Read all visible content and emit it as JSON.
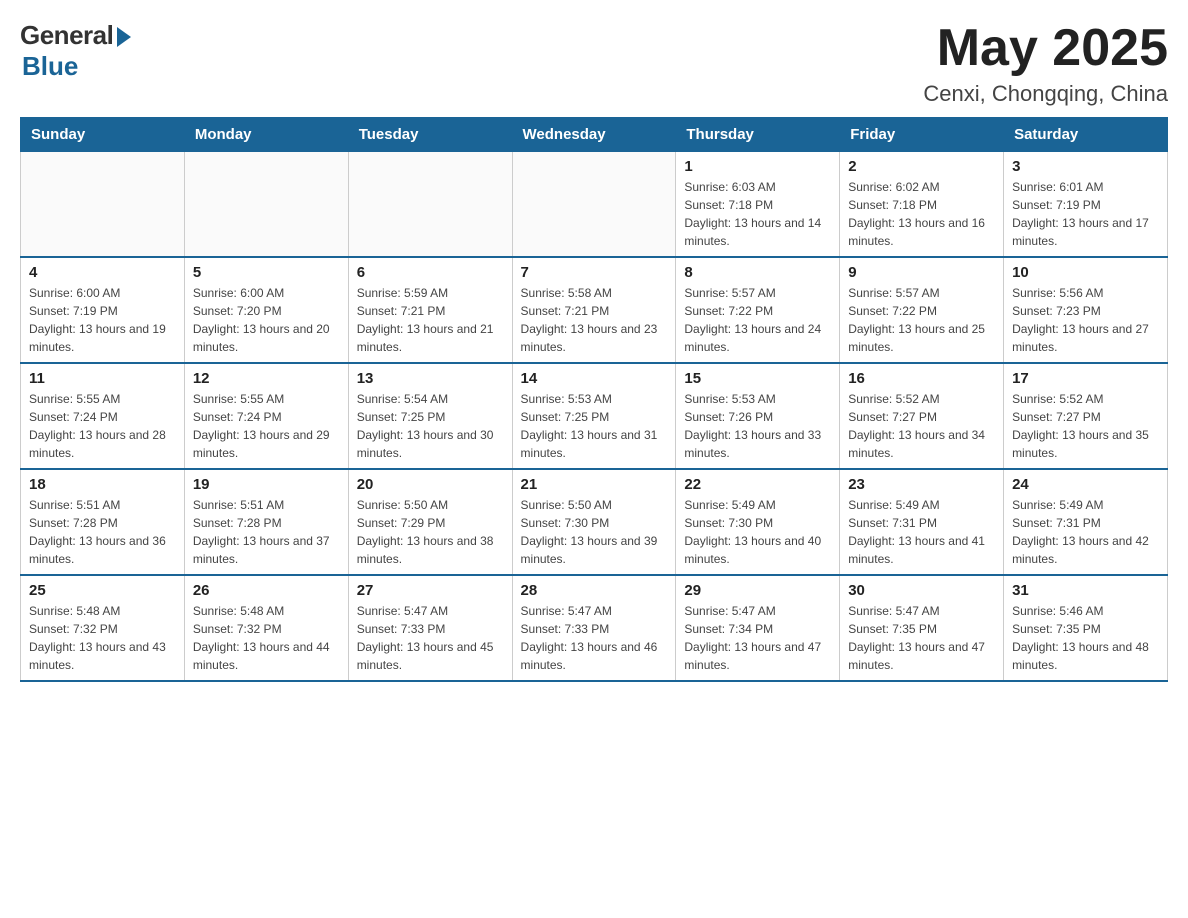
{
  "logo": {
    "general": "General",
    "blue": "Blue"
  },
  "title": "May 2025",
  "subtitle": "Cenxi, Chongqing, China",
  "days_header": [
    "Sunday",
    "Monday",
    "Tuesday",
    "Wednesday",
    "Thursday",
    "Friday",
    "Saturday"
  ],
  "weeks": [
    [
      {
        "day": "",
        "info": ""
      },
      {
        "day": "",
        "info": ""
      },
      {
        "day": "",
        "info": ""
      },
      {
        "day": "",
        "info": ""
      },
      {
        "day": "1",
        "info": "Sunrise: 6:03 AM\nSunset: 7:18 PM\nDaylight: 13 hours and 14 minutes."
      },
      {
        "day": "2",
        "info": "Sunrise: 6:02 AM\nSunset: 7:18 PM\nDaylight: 13 hours and 16 minutes."
      },
      {
        "day": "3",
        "info": "Sunrise: 6:01 AM\nSunset: 7:19 PM\nDaylight: 13 hours and 17 minutes."
      }
    ],
    [
      {
        "day": "4",
        "info": "Sunrise: 6:00 AM\nSunset: 7:19 PM\nDaylight: 13 hours and 19 minutes."
      },
      {
        "day": "5",
        "info": "Sunrise: 6:00 AM\nSunset: 7:20 PM\nDaylight: 13 hours and 20 minutes."
      },
      {
        "day": "6",
        "info": "Sunrise: 5:59 AM\nSunset: 7:21 PM\nDaylight: 13 hours and 21 minutes."
      },
      {
        "day": "7",
        "info": "Sunrise: 5:58 AM\nSunset: 7:21 PM\nDaylight: 13 hours and 23 minutes."
      },
      {
        "day": "8",
        "info": "Sunrise: 5:57 AM\nSunset: 7:22 PM\nDaylight: 13 hours and 24 minutes."
      },
      {
        "day": "9",
        "info": "Sunrise: 5:57 AM\nSunset: 7:22 PM\nDaylight: 13 hours and 25 minutes."
      },
      {
        "day": "10",
        "info": "Sunrise: 5:56 AM\nSunset: 7:23 PM\nDaylight: 13 hours and 27 minutes."
      }
    ],
    [
      {
        "day": "11",
        "info": "Sunrise: 5:55 AM\nSunset: 7:24 PM\nDaylight: 13 hours and 28 minutes."
      },
      {
        "day": "12",
        "info": "Sunrise: 5:55 AM\nSunset: 7:24 PM\nDaylight: 13 hours and 29 minutes."
      },
      {
        "day": "13",
        "info": "Sunrise: 5:54 AM\nSunset: 7:25 PM\nDaylight: 13 hours and 30 minutes."
      },
      {
        "day": "14",
        "info": "Sunrise: 5:53 AM\nSunset: 7:25 PM\nDaylight: 13 hours and 31 minutes."
      },
      {
        "day": "15",
        "info": "Sunrise: 5:53 AM\nSunset: 7:26 PM\nDaylight: 13 hours and 33 minutes."
      },
      {
        "day": "16",
        "info": "Sunrise: 5:52 AM\nSunset: 7:27 PM\nDaylight: 13 hours and 34 minutes."
      },
      {
        "day": "17",
        "info": "Sunrise: 5:52 AM\nSunset: 7:27 PM\nDaylight: 13 hours and 35 minutes."
      }
    ],
    [
      {
        "day": "18",
        "info": "Sunrise: 5:51 AM\nSunset: 7:28 PM\nDaylight: 13 hours and 36 minutes."
      },
      {
        "day": "19",
        "info": "Sunrise: 5:51 AM\nSunset: 7:28 PM\nDaylight: 13 hours and 37 minutes."
      },
      {
        "day": "20",
        "info": "Sunrise: 5:50 AM\nSunset: 7:29 PM\nDaylight: 13 hours and 38 minutes."
      },
      {
        "day": "21",
        "info": "Sunrise: 5:50 AM\nSunset: 7:30 PM\nDaylight: 13 hours and 39 minutes."
      },
      {
        "day": "22",
        "info": "Sunrise: 5:49 AM\nSunset: 7:30 PM\nDaylight: 13 hours and 40 minutes."
      },
      {
        "day": "23",
        "info": "Sunrise: 5:49 AM\nSunset: 7:31 PM\nDaylight: 13 hours and 41 minutes."
      },
      {
        "day": "24",
        "info": "Sunrise: 5:49 AM\nSunset: 7:31 PM\nDaylight: 13 hours and 42 minutes."
      }
    ],
    [
      {
        "day": "25",
        "info": "Sunrise: 5:48 AM\nSunset: 7:32 PM\nDaylight: 13 hours and 43 minutes."
      },
      {
        "day": "26",
        "info": "Sunrise: 5:48 AM\nSunset: 7:32 PM\nDaylight: 13 hours and 44 minutes."
      },
      {
        "day": "27",
        "info": "Sunrise: 5:47 AM\nSunset: 7:33 PM\nDaylight: 13 hours and 45 minutes."
      },
      {
        "day": "28",
        "info": "Sunrise: 5:47 AM\nSunset: 7:33 PM\nDaylight: 13 hours and 46 minutes."
      },
      {
        "day": "29",
        "info": "Sunrise: 5:47 AM\nSunset: 7:34 PM\nDaylight: 13 hours and 47 minutes."
      },
      {
        "day": "30",
        "info": "Sunrise: 5:47 AM\nSunset: 7:35 PM\nDaylight: 13 hours and 47 minutes."
      },
      {
        "day": "31",
        "info": "Sunrise: 5:46 AM\nSunset: 7:35 PM\nDaylight: 13 hours and 48 minutes."
      }
    ]
  ]
}
